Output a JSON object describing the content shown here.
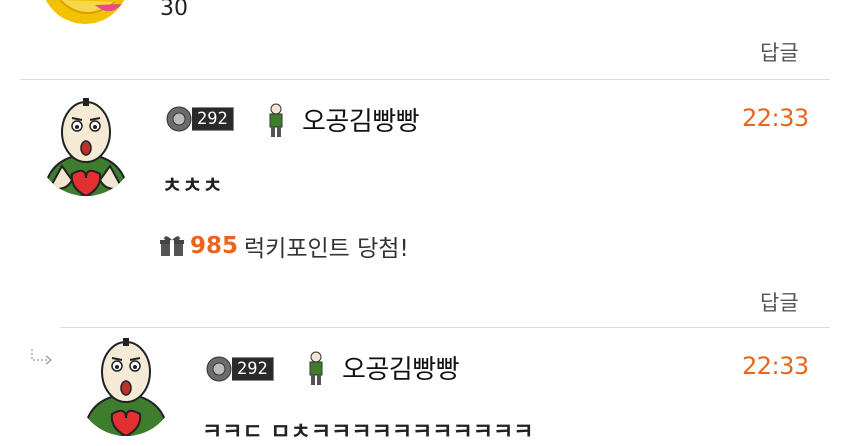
{
  "top_comment": {
    "text": "30",
    "reply_label": "답글"
  },
  "comments": [
    {
      "level": "292",
      "nickname": "오공김빵빵",
      "time": "22:33",
      "text": "ㅊㅊㅊ",
      "lucky_points": "985",
      "lucky_text": "럭키포인트 당첨!",
      "reply_label": "답글"
    },
    {
      "level": "292",
      "nickname": "오공김빵빵",
      "time": "22:33",
      "text": "ㅋㅋㄷ ㅁㅊㅋㅋㅋㅋㅋㅋㅋㅋㅋㅋㅋ"
    }
  ],
  "colors": {
    "accent": "#e8661c",
    "divider": "#dcdcdc"
  }
}
